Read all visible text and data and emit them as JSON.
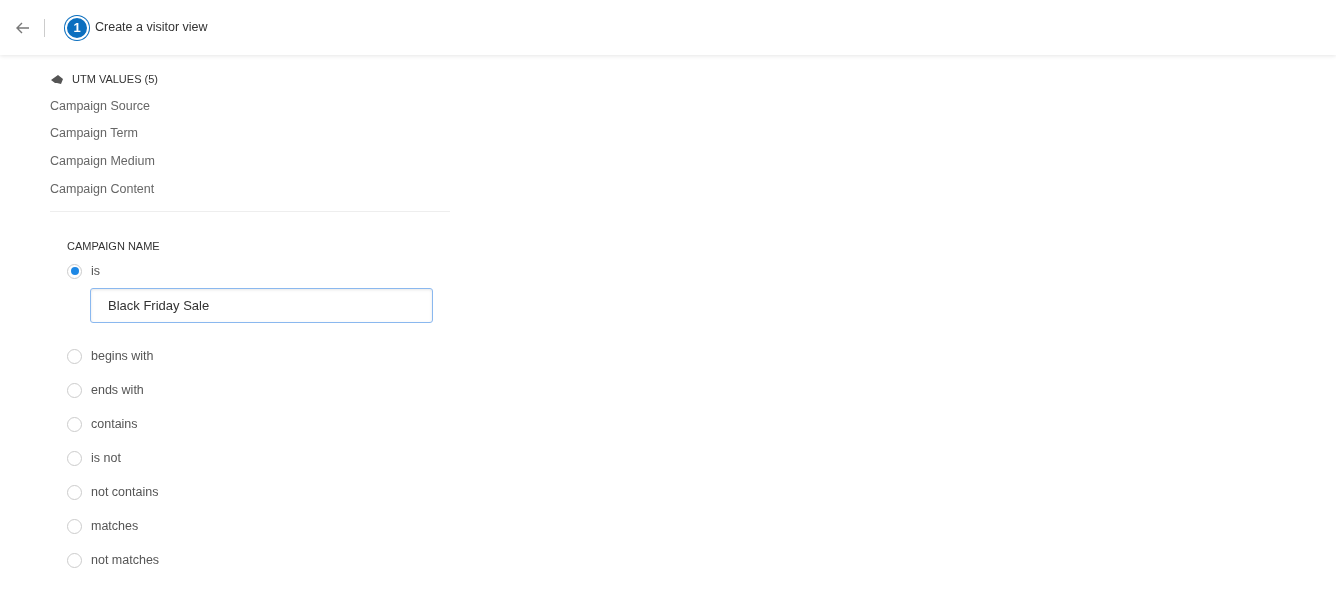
{
  "header": {
    "step": "1",
    "title": "Create a visitor view"
  },
  "utm": {
    "heading": "UTM VALUES (5)",
    "items": [
      "Campaign Source",
      "Campaign Term",
      "Campaign Medium",
      "Campaign Content"
    ]
  },
  "filter": {
    "label": "CAMPAIGN NAME",
    "options": [
      {
        "label": "is",
        "selected": true,
        "value": "Black Friday Sale"
      },
      {
        "label": "begins with",
        "selected": false
      },
      {
        "label": "ends with",
        "selected": false
      },
      {
        "label": "contains",
        "selected": false
      },
      {
        "label": "is not",
        "selected": false
      },
      {
        "label": "not contains",
        "selected": false
      },
      {
        "label": "matches",
        "selected": false
      },
      {
        "label": "not matches",
        "selected": false
      }
    ]
  }
}
